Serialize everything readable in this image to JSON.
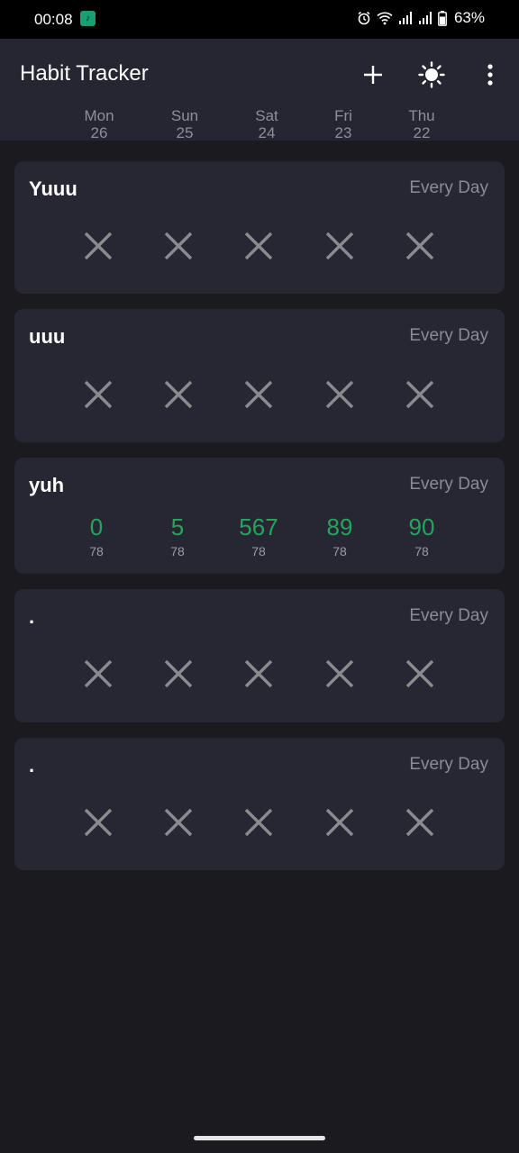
{
  "status_bar": {
    "time": "00:08",
    "notif_icon": "app-notification-icon",
    "battery": "63%"
  },
  "app": {
    "title": "Habit Tracker",
    "actions": {
      "add_icon": "plus-icon",
      "theme_icon": "brightness-icon",
      "more_icon": "more-vert-icon"
    }
  },
  "days": [
    {
      "name": "Mon",
      "num": "26"
    },
    {
      "name": "Sun",
      "num": "25"
    },
    {
      "name": "Sat",
      "num": "24"
    },
    {
      "name": "Fri",
      "num": "23"
    },
    {
      "name": "Thu",
      "num": "22"
    }
  ],
  "habits": [
    {
      "name": "Yuuu",
      "frequency": "Every Day",
      "type": "checkmark",
      "marks": [
        "x",
        "x",
        "x",
        "x",
        "x"
      ]
    },
    {
      "name": "uuu",
      "frequency": "Every Day",
      "type": "checkmark",
      "marks": [
        "x",
        "x",
        "x",
        "x",
        "x"
      ]
    },
    {
      "name": "yuh",
      "frequency": "Every Day",
      "type": "numeric",
      "values": [
        {
          "value": "0",
          "target": "78"
        },
        {
          "value": "5",
          "target": "78"
        },
        {
          "value": "567",
          "target": "78"
        },
        {
          "value": "89",
          "target": "78"
        },
        {
          "value": "90",
          "target": "78"
        }
      ]
    },
    {
      "name": ".",
      "frequency": "Every Day",
      "type": "checkmark",
      "marks": [
        "x",
        "x",
        "x",
        "x",
        "x"
      ]
    },
    {
      "name": ".",
      "frequency": "Every Day",
      "type": "checkmark",
      "marks": [
        "x",
        "x",
        "x",
        "x",
        "x"
      ]
    }
  ],
  "colors": {
    "background": "#1a1a1f",
    "header": "#252632",
    "card": "#262733",
    "numeric_value": "#27a35e",
    "x_mark": "#8a8a8f"
  }
}
